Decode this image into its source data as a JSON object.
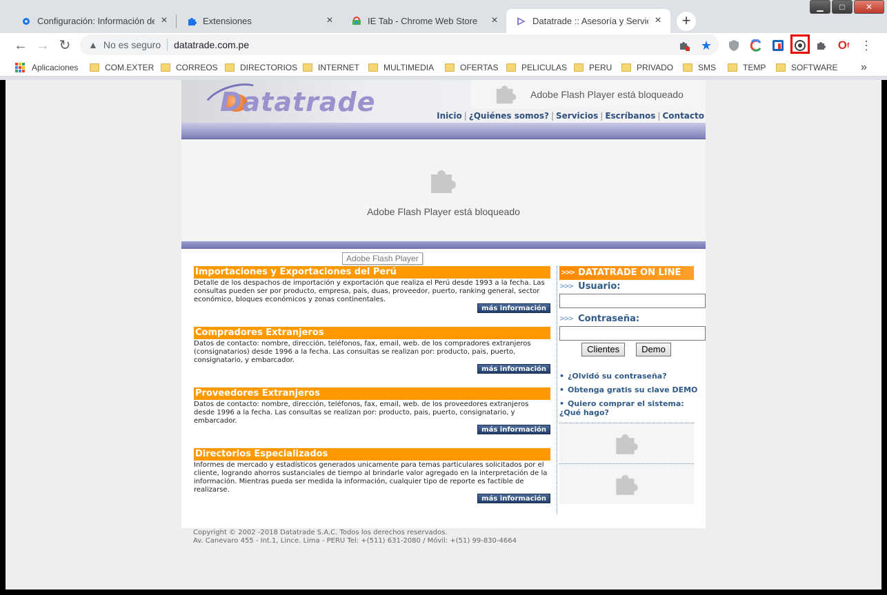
{
  "browser": {
    "tabs": [
      {
        "title": "Configuración: Información de Ch",
        "icon": "gear-icon",
        "active": false
      },
      {
        "title": "Extensiones",
        "icon": "puzzle-icon",
        "active": false
      },
      {
        "title": "IE Tab - Chrome Web Store",
        "icon": "webstore-icon",
        "active": false
      },
      {
        "title": "Datatrade :: Asesoría y Servicios d",
        "icon": "datatrade-icon",
        "active": true
      }
    ],
    "new_tab": "+",
    "security_label": "No es seguro",
    "url": "datatrade.com.pe",
    "bookmarks": [
      {
        "label": "Aplicaciones",
        "type": "apps"
      },
      {
        "label": "COM.EXTER",
        "type": "folder"
      },
      {
        "label": "CORREOS",
        "type": "folder"
      },
      {
        "label": "DIRECTORIOS",
        "type": "folder"
      },
      {
        "label": "INTERNET",
        "type": "folder"
      },
      {
        "label": "MULTIMEDIA",
        "type": "folder"
      },
      {
        "label": "OFERTAS",
        "type": "folder"
      },
      {
        "label": "PELICULAS",
        "type": "folder"
      },
      {
        "label": "PERU",
        "type": "folder"
      },
      {
        "label": "PRIVADO",
        "type": "folder"
      },
      {
        "label": "SMS",
        "type": "folder"
      },
      {
        "label": "TEMP",
        "type": "folder"
      },
      {
        "label": "SOFTWARE",
        "type": "folder"
      }
    ],
    "overflow": "»"
  },
  "site": {
    "logo": "Datatrade",
    "header_flash": "Adobe Flash Player está bloqueado",
    "nav": [
      "Inicio",
      "¿Quiénes somos?",
      "Servicios",
      "Escríbanos",
      "Contacto"
    ],
    "main_flash": "Adobe Flash Player está bloqueado",
    "tooltip": "Adobe Flash Player",
    "more_label": "más información",
    "sections": [
      {
        "title": "Importaciones y Exportaciones del Perú",
        "body": "Detalle de los despachos de importación y exportación que realiza el Perú desde 1993 a la fecha. Las consultas pueden ser por producto, empresa, pais, duas, proveedor, puerto, ranking general, sector económico, bloques económicos y zonas continentales."
      },
      {
        "title": "Compradores Extranjeros",
        "body": "Datos de contacto: nombre, dirección, teléfonos, fax, email, web. de los compradores extranjeros (consignatarios) desde 1996 a la fecha. Las consultas se realizan por: producto, pais, puerto, consignatario, y embarcador."
      },
      {
        "title": "Proveedores Extranjeros",
        "body": "Datos de contacto: nombre, dirección, teléfonos, fax, email, web. de los proveedores extranjeros desde 1996 a la fecha. Las consultas se realizan por: producto, pais, puerto, consignatario, y embarcador."
      },
      {
        "title": "Directorios Especializados",
        "body": "Informes de mercado y estadísticos generados unicamente para temas particulares solicitados por el cliente, logrando ahorros sustanciales de tiempo al brindarle valor agregado en la interpretación de la información. Mientras pueda ser medida la información, cualquier tipo de reporte es factible de realizarse."
      }
    ],
    "online": {
      "title": "DATATRADE ON LINE",
      "user_label": "Usuario:",
      "password_label": "Contraseña:",
      "clients_btn": "Clientes",
      "demo_btn": "Demo",
      "links": [
        "¿Olvidó su contraseña?",
        "Obtenga gratis su clave DEMO",
        "Quiero comprar el sistema: ¿Qué hago?"
      ]
    },
    "footer": {
      "line1": "Copyright © 2002 -2018 Datatrade S.A.C. Todos los derechos reservados.",
      "line2": "Av. Canevaro 455 - Int.1, Lince. Lima - PERU Tel: +(511) 631-2080 / Móvil: +(51) 99-830-4664"
    }
  },
  "colors": {
    "orange": "#ff9900",
    "nav_blue": "#2f4f7f",
    "highlight_red": "#ee0000"
  }
}
